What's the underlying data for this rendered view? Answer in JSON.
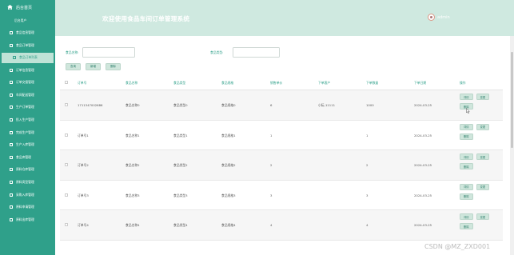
{
  "sidebar": {
    "home_label": "后台首页",
    "items": [
      {
        "label": "后台用户",
        "sub": true
      },
      {
        "label": "食品信息管理"
      },
      {
        "label": "食品订单管理"
      },
      {
        "label": "食品订单列表",
        "active": true
      },
      {
        "label": "订单信息管理"
      },
      {
        "label": "订单交接管理"
      },
      {
        "label": "车间配送管理"
      },
      {
        "label": "生产订单管理"
      },
      {
        "label": "投入生产管理"
      },
      {
        "label": "完成生产管理"
      },
      {
        "label": "生产入库管理"
      },
      {
        "label": "食品库管理"
      },
      {
        "label": "原料仓库管理"
      },
      {
        "label": "原料类型管理"
      },
      {
        "label": "采购入库管理"
      },
      {
        "label": "原料申请管理"
      },
      {
        "label": "原料出库管理"
      }
    ]
  },
  "header": {
    "title": "欢迎使用食品车间订单管理系统",
    "user": "admin"
  },
  "search": {
    "name_label": "食品名称:",
    "type_label": "食品类型:"
  },
  "toolbar": {
    "search_label": "查询",
    "add_label": "新增",
    "delete_label": "删除"
  },
  "table": {
    "columns": [
      "订单号",
      "食品名称",
      "食品类型",
      "食品规格",
      "销售单价",
      "下单客户",
      "下单数量",
      "下单日期",
      "操作"
    ],
    "rows": [
      {
        "order": "1711347002686",
        "name": "食品名称0",
        "type": "食品类型0",
        "spec": "食品规格0",
        "price": "6",
        "customer": "小阮-11111",
        "qty": "1000",
        "date": "2024-03-25"
      },
      {
        "order": "订单号1",
        "name": "食品名称1",
        "type": "食品类型1",
        "spec": "食品规格1",
        "price": "1",
        "customer": "",
        "qty": "1",
        "date": "2024-03-25"
      },
      {
        "order": "订单号2",
        "name": "食品名称2",
        "type": "食品类型2",
        "spec": "食品规格2",
        "price": "2",
        "customer": "",
        "qty": "2",
        "date": "2024-03-25"
      },
      {
        "order": "订单号3",
        "name": "食品名称3",
        "type": "食品类型3",
        "spec": "食品规格3",
        "price": "3",
        "customer": "",
        "qty": "3",
        "date": "2024-03-25"
      },
      {
        "order": "订单号4",
        "name": "食品名称4",
        "type": "食品类型4",
        "spec": "食品规格4",
        "price": "4",
        "customer": "",
        "qty": "4",
        "date": "2024-03-25"
      }
    ],
    "op_detail": "详情",
    "op_edit": "变更",
    "op_delete": "删除"
  },
  "watermark": "CSDN @MZ_ZXD001",
  "colors": {
    "accent": "#2fa08a",
    "header_bg": "#cfe9e0",
    "button_bg": "#cfe6dc"
  }
}
